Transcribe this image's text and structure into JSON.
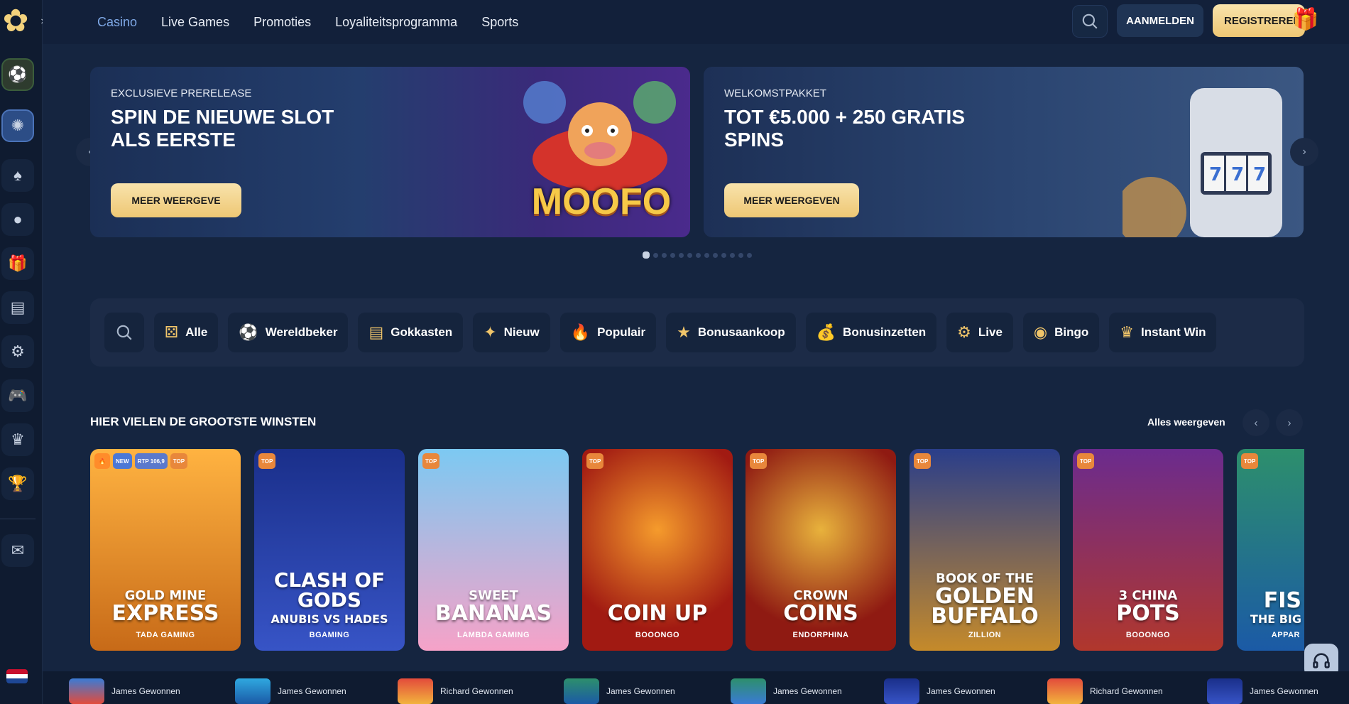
{
  "topnav": {
    "items": [
      "Casino",
      "Live Games",
      "Promoties",
      "Loyaliteitsprogramma",
      "Sports"
    ],
    "login_label": "AANMELDEN",
    "register_label": "REGISTREREN"
  },
  "sidebar": {
    "items": [
      "football-icon",
      "casino-chip-icon",
      "spade-icon",
      "ball-icon",
      "gift-icon",
      "slot-icon",
      "wheel-icon",
      "gamepad-icon",
      "crown-icon",
      "trophy-icon",
      "mail-icon"
    ],
    "language_flag": "netherlands-flag-icon"
  },
  "banners": [
    {
      "overline": "EXCLUSIEVE PRERELEASE",
      "headline": "SPIN DE NIEUWE SLOT ALS EERSTE",
      "cta": "MEER WEERGEVE",
      "art_text": "MOOFO"
    },
    {
      "overline": "WELKOMSTPAKKET",
      "headline": "TOT €5.000 + 250 GRATIS SPINS",
      "cta": "MEER WEERGEVEN"
    }
  ],
  "carousel": {
    "total": 13,
    "active": 1
  },
  "categories": [
    "Alle",
    "Wereldbeker",
    "Gokkasten",
    "Nieuw",
    "Populair",
    "Bonusaankoop",
    "Bonusinzetten",
    "Live",
    "Bingo",
    "Instant Win"
  ],
  "section": {
    "title": "HIER VIELEN DE GROOTSTE WINSTEN",
    "view_all": "Alles weergeven"
  },
  "games": [
    {
      "title_line1": "GOLD MINE",
      "title_line2": "EXPRESS",
      "provider": "TADA GAMING",
      "tags": [
        "fire",
        "NEW",
        "RTP 106,9",
        "TOP"
      ]
    },
    {
      "title_line1": "CLASH OF",
      "title_line2": "GODS",
      "title_line3": "ANUBIS VS HADES",
      "provider": "BGAMING",
      "tags": [
        "TOP"
      ]
    },
    {
      "title_line1": "SWEET",
      "title_line2": "BANANAS",
      "provider": "LAMBDA GAMING",
      "tags": [
        "TOP"
      ]
    },
    {
      "title_line1": "COIN UP",
      "provider": "BOOONGO",
      "tags": [
        "TOP"
      ]
    },
    {
      "title_line1": "CROWN",
      "title_line2": "COINS",
      "provider": "ENDORPHINA",
      "tags": [
        "TOP"
      ]
    },
    {
      "title_line1": "BOOK OF THE",
      "title_line2": "GOLDEN",
      "title_line3": "BUFFALO",
      "provider": "ZILLION",
      "tags": [
        "TOP"
      ]
    },
    {
      "title_line1": "3 CHINA",
      "title_line2": "POTS",
      "provider": "BOOONGO",
      "tags": [
        "TOP"
      ]
    },
    {
      "title_line1": "FIS",
      "title_line2": "THE BIG",
      "provider": "APPAR",
      "tags": [
        "TOP"
      ]
    }
  ],
  "winners": [
    {
      "text": "James Gewonnen"
    },
    {
      "text": "James Gewonnen"
    },
    {
      "text": "Richard Gewonnen"
    },
    {
      "text": "James Gewonnen"
    },
    {
      "text": "James Gewonnen"
    },
    {
      "text": "James Gewonnen"
    },
    {
      "text": "Richard Gewonnen"
    },
    {
      "text": "James Gewonnen"
    }
  ]
}
